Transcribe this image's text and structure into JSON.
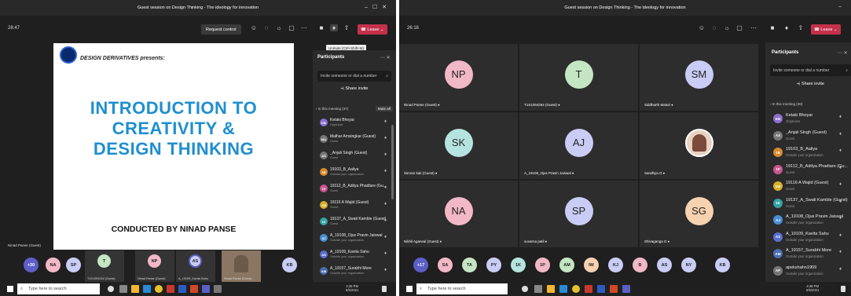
{
  "window1": {
    "title": "Guest session on Design Thinking - The ideology for innovation",
    "timer": "28:47",
    "request_control": "Request control",
    "leave": "Leave",
    "tooltip": "Unmute (Ctrl+Shift+M)",
    "slide": {
      "brand": "DESIGN DERIVATIVES presents:",
      "title_lines": [
        "INTRODUCTION TO",
        "CREATIVITY &",
        "DESIGN THINKING"
      ],
      "footer": "CONDUCTED BY NINAD PANSE"
    },
    "own_label": "Ninad Panse (Guest)",
    "panel": {
      "title": "Participants",
      "invite_placeholder": "Invite someone or dial a number",
      "share_invite": "Share invite",
      "in_meeting": "In this meeting (37)",
      "mute_all": "Mute all",
      "participants": [
        {
          "initials": "KB",
          "name": "Ketaki Bhoyar",
          "sub": "Organizer",
          "color": "#8b6fd0"
        },
        {
          "initials": "MA",
          "name": "Malhar Amsingkar (Guest)",
          "sub": "Guest",
          "color": "#777777"
        },
        {
          "initials": "AS",
          "name": "_Anjali Singh (Guest)",
          "sub": "Guest",
          "color": "#777777"
        },
        {
          "initials": "1B",
          "name": "19103_B_Aaliya",
          "sub": "Outside your organization",
          "color": "#d9892d"
        },
        {
          "initials": "1P",
          "name": "19112_B_Aditya Phadtare (Gu...",
          "sub": "Guest",
          "color": "#c9568e"
        },
        {
          "initials": "1W",
          "name": "19116 A Wajid (Guest)",
          "sub": "Guest",
          "color": "#d6b02a"
        },
        {
          "initials": "1K",
          "name": "19137_A_Swati Kamble (Guest)",
          "sub": "Guest",
          "color": "#35a3a3"
        },
        {
          "initials": "AJ",
          "name": "A_19108_Ojus Pravin Jaiswal",
          "sub": "Outside your organization",
          "color": "#4a8fd6"
        },
        {
          "initials": "AS",
          "name": "A_19109_Kavita Sahu",
          "sub": "Outside your organization",
          "color": "#5a6fd0"
        },
        {
          "initials": "AM",
          "name": "A_19157_Surabhi More",
          "sub": "Outside your organization",
          "color": "#4d6fb0"
        }
      ]
    },
    "strip": [
      {
        "initials": "+30",
        "color": "#5b5fc7"
      },
      {
        "initials": "NA",
        "color": "#f2b8c6"
      },
      {
        "initials": "SP",
        "color": "#c9cdf5"
      }
    ],
    "strip_tiles": [
      {
        "initials": "T",
        "color": "#c4e6c2",
        "label": "T1S1094264 (Guest)"
      },
      {
        "initials": "NP",
        "color": "#f2b8c6",
        "label": "Ninad Panse (Guest)"
      },
      {
        "initials": "AS",
        "color": "#c9cdf5",
        "label": "A_19109_Kavita Sahu"
      },
      {
        "initials": "",
        "color": "#6b5a48",
        "label": "Ninad Panse (Guest)"
      }
    ],
    "strip_end": {
      "initials": "KB",
      "color": "#c9cdf5"
    },
    "taskbar": {
      "search": "Type here to search",
      "time": "4:45 PM",
      "date": "6/5/2021"
    }
  },
  "window2": {
    "title": "Guest session on Design Thinking - The ideology for innovation",
    "timer": "26:16",
    "leave": "Leave",
    "tiles": [
      {
        "initials": "NP",
        "color": "#f2b8c6",
        "name": "Ninad Panse (Guest)"
      },
      {
        "initials": "T",
        "color": "#c4e6c2",
        "name": "T1S1094264 (Guest)"
      },
      {
        "initials": "SM",
        "color": "#c9cdf5",
        "name": "Siddharth Maturi"
      },
      {
        "initials": "SK",
        "color": "#b5e3e0",
        "name": "Simran kak (Guest)"
      },
      {
        "initials": "AJ",
        "color": "#c9cdf5",
        "name": "A_19108_Ojus Pravin Jaiswal"
      },
      {
        "initials": "",
        "color": "#e8d2c2",
        "name": "Sandhya G"
      },
      {
        "initials": "NA",
        "color": "#f2b8c6",
        "name": "Nikhil Agarwal (Guest)"
      },
      {
        "initials": "SP",
        "color": "#c9cdf5",
        "name": "suvarna patil"
      },
      {
        "initials": "SG",
        "color": "#f6d2b0",
        "name": "Shivaganga G"
      }
    ],
    "panel": {
      "title": "Participants",
      "invite_placeholder": "Invite someone or dial a number",
      "share_invite": "Share invite",
      "in_meeting": "In this meeting (38)",
      "participants": [
        {
          "initials": "KB",
          "name": "Ketaki Bhoyar",
          "sub": "Organizer",
          "color": "#8b6fd0"
        },
        {
          "initials": "AS",
          "name": "_Anjali Singh (Guest)",
          "sub": "Guest",
          "color": "#777777"
        },
        {
          "initials": "1B",
          "name": "19103_B_Aaliya",
          "sub": "Outside your organization",
          "color": "#d9892d"
        },
        {
          "initials": "1P",
          "name": "19112_B_Aditya Phadtare (Gu...",
          "sub": "Guest",
          "color": "#c9568e"
        },
        {
          "initials": "1W",
          "name": "19116 A Wajid (Guest)",
          "sub": "Guest",
          "color": "#d6b02a"
        },
        {
          "initials": "1K",
          "name": "19137_A_Swati Kamble (Guest)",
          "sub": "Guest",
          "color": "#35a3a3"
        },
        {
          "initials": "AJ",
          "name": "A_19108_Ojus Pravin Jaiswal",
          "sub": "Outside your organization",
          "color": "#4a8fd6"
        },
        {
          "initials": "AS",
          "name": "A_19109_Kavita Sahu",
          "sub": "Outside your organization",
          "color": "#5a6fd0"
        },
        {
          "initials": "AM",
          "name": "A_19157_Surabhi More",
          "sub": "Outside your organization",
          "color": "#4d6fb0"
        },
        {
          "initials": "AP",
          "name": "apekshahn1909",
          "sub": "Outside your organization",
          "color": "#777777"
        }
      ]
    },
    "strip": [
      {
        "initials": "+17",
        "color": "#5b5fc7"
      },
      {
        "initials": "SA",
        "color": "#f2b8c6"
      },
      {
        "initials": "TA",
        "color": "#c4e6c2"
      },
      {
        "initials": "PY",
        "color": "#c9cdf5"
      },
      {
        "initials": "1K",
        "color": "#b5e3e0"
      },
      {
        "initials": "1P",
        "color": "#f2b8c6"
      },
      {
        "initials": "AM",
        "color": "#c4e6c2"
      },
      {
        "initials": "IW",
        "color": "#f6d2b0"
      },
      {
        "initials": "KJ",
        "color": "#c9cdf5"
      },
      {
        "initials": "B",
        "color": "#f2b8c6"
      },
      {
        "initials": "AS",
        "color": "#c9cdf5"
      },
      {
        "initials": "NY",
        "color": "#c9cdf5"
      },
      {
        "initials": "KB",
        "color": "#c9cdf5"
      }
    ],
    "taskbar": {
      "search": "Type here to search",
      "time": "4:46 PM",
      "date": "6/5/2021"
    }
  }
}
